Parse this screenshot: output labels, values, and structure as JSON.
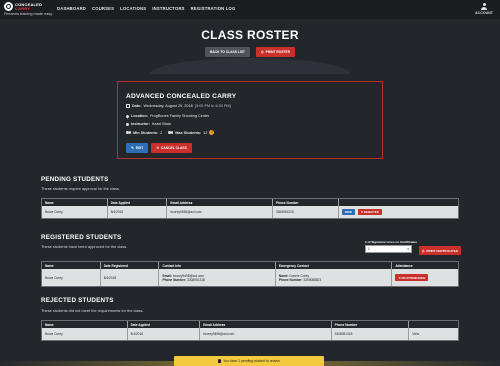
{
  "brand": {
    "logo_line1": "CONCEALED",
    "logo_line2": "CARRY",
    "tagline": "Firearms training made easy."
  },
  "nav": {
    "items": [
      "DASHBOARD",
      "COURSES",
      "LOCATIONS",
      "INSTRUCTORS",
      "REGISTRATION LOG"
    ],
    "account_label": "ACCOUNT"
  },
  "header": {
    "title": "CLASS ROSTER",
    "back_button": "BACK TO CLASS LIST",
    "print_button": "PRINT ROSTER"
  },
  "class": {
    "title": "ADVANCED CONCEALED CARRY",
    "date_label": "Date:",
    "date_value": "Wednesday, August 29, 2018",
    "time_value": "(5:00 PM to 6:30 PM)",
    "location_label": "Location:",
    "location_value": "FrogBones Family Shooting Center",
    "instructor_label": "Instructor:",
    "instructor_value": "Israel Mata",
    "min_label": "Min Students:",
    "min_value": "2",
    "max_label": "Max Students:",
    "max_value": "12",
    "edit_button": "EDIT",
    "cancel_button": "CANCEL CLASS"
  },
  "pending": {
    "title": "PENDING STUDENTS",
    "subtitle": "These students require approval for the class.",
    "headers": [
      "Name",
      "Date Applied",
      "Email Address",
      "Phone Number",
      ""
    ],
    "rows": [
      {
        "name": "Bruce Corey",
        "date": "8/4/2018",
        "email": "bcorey9498@aol.com",
        "phone": "3308051318",
        "view": "VIEW",
        "reject": "REJECTED"
      }
    ]
  },
  "registered": {
    "title": "REGISTERED STUDENTS",
    "subtitle": "These students have been approved for the class.",
    "signature_label": "# of Signature Lines on Certificates",
    "signature_value": "1",
    "print_certs": "PRINT CERTIFICATES",
    "headers": [
      "Name",
      "Date Registered",
      "Contact Info",
      "Emergency Contact",
      "Attendance"
    ],
    "rows": [
      {
        "name": "Bruce Corey",
        "date": "8/4/2018",
        "email_label": "Email:",
        "email": "bcorey9498@aol.com",
        "phone_label": "Phone Number:",
        "phone": "3308051318",
        "ec_name_label": "Name:",
        "ec_name": "Donnie Corey",
        "ec_phone_label": "Phone Number:",
        "ec_phone": "3308088823",
        "attendance": "NO ATTENDANCE"
      }
    ]
  },
  "rejected": {
    "title": "REJECTED STUDENTS",
    "subtitle": "These students did not meet the requirements for the class.",
    "headers": [
      "Name",
      "Date Applied",
      "Email Address",
      "Phone Number",
      ""
    ],
    "rows": [
      {
        "name": "Bruce Corey",
        "date": "8/4/2018",
        "email": "bcorey9498@aol.com",
        "phone": "3308051318",
        "view": "View"
      }
    ]
  },
  "notice": {
    "text": "You have 1 pending student to review."
  },
  "colors": {
    "background": "#23262b",
    "accent_red": "#c9302c",
    "accent_blue": "#2f6db5",
    "notice_yellow": "#f3ca3e"
  }
}
